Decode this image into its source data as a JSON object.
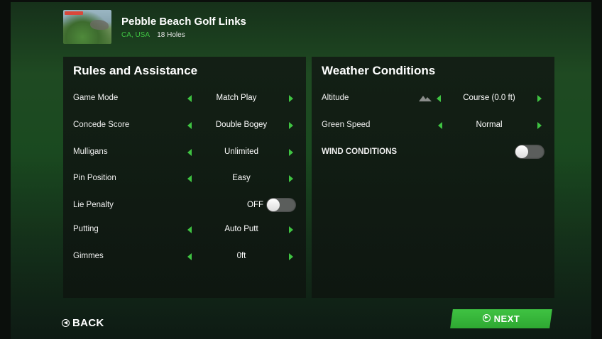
{
  "course": {
    "name": "Pebble Beach Golf Links",
    "location": "CA, USA",
    "holes": "18 Holes"
  },
  "rules": {
    "title": "Rules and Assistance",
    "items": [
      {
        "label": "Game Mode",
        "value": "Match Play"
      },
      {
        "label": "Concede Score",
        "value": "Double Bogey"
      },
      {
        "label": "Mulligans",
        "value": "Unlimited"
      },
      {
        "label": "Pin Position",
        "value": "Easy"
      },
      {
        "label": "Lie Penalty",
        "value": "OFF",
        "toggle": false
      },
      {
        "label": "Putting",
        "value": "Auto Putt"
      },
      {
        "label": "Gimmes",
        "value": "0ft"
      }
    ]
  },
  "weather": {
    "title": "Weather Conditions",
    "items": [
      {
        "label": "Altitude",
        "value": "Course (0.0 ft)",
        "icon": "mountain-icon"
      },
      {
        "label": "Green Speed",
        "value": "Normal"
      },
      {
        "label": "WIND CONDITIONS",
        "toggle": false
      }
    ]
  },
  "nav": {
    "back_label": "BACK",
    "next_label": "NEXT"
  },
  "colors": {
    "accent": "#3fc342",
    "panel": "#121c14"
  }
}
